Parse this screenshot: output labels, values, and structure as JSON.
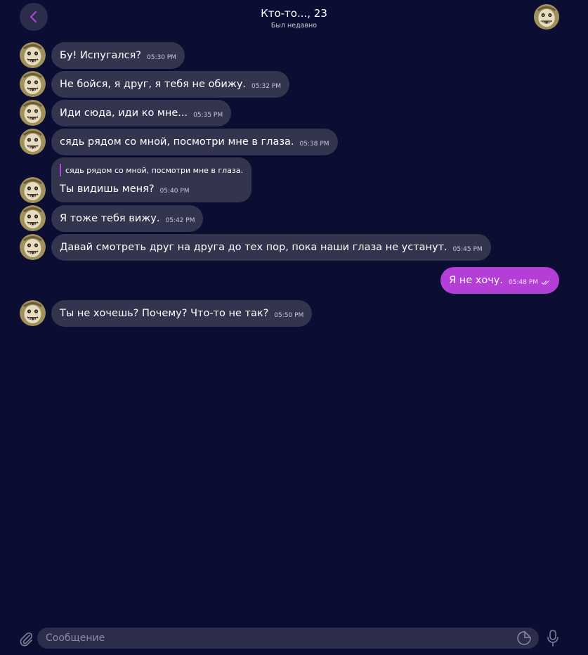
{
  "header": {
    "title": "Кто-то..., 23",
    "status": "Был недавно",
    "back_icon": "chevron-left-icon",
    "avatar_icon": "contact-avatar"
  },
  "colors": {
    "background": "#0c0d33",
    "incoming_bubble": "#33354f",
    "outgoing_bubble": "#b43fd6",
    "accent": "#b144d8"
  },
  "messages": [
    {
      "text": "Бу! Испугался?",
      "time": "05:30 PM",
      "direction": "in"
    },
    {
      "text": "Не бойся, я друг, я тебя не обижу.",
      "time": "05:32 PM",
      "direction": "in"
    },
    {
      "text": "Иди сюда, иди ко мне...",
      "time": "05:35 PM",
      "direction": "in"
    },
    {
      "text": "сядь рядом со мной, посмотри мне в глаза.",
      "time": "05:38 PM",
      "direction": "in"
    },
    {
      "quote": "сядь рядом со мной, посмотри мне в глаза.",
      "text": "Ты видишь меня?",
      "time": "05:40 PM",
      "direction": "in"
    },
    {
      "text": "Я тоже тебя вижу.",
      "time": "05:42 PM",
      "direction": "in"
    },
    {
      "text": "Давай смотреть друг на друга до тех пор, пока наши глаза не устанут.",
      "time": "05:45 PM",
      "direction": "in"
    },
    {
      "text": "Я не хочу.",
      "time": "05:48 PM",
      "direction": "out",
      "status_icon": "double-check-icon"
    },
    {
      "text": "Ты не хочешь? Почему? Что-то не так?",
      "time": "05:50 PM",
      "direction": "in"
    }
  ],
  "composer": {
    "placeholder": "Сообщение",
    "attach_icon": "paperclip-icon",
    "sticker_icon": "sticker-icon",
    "mic_icon": "microphone-icon"
  }
}
